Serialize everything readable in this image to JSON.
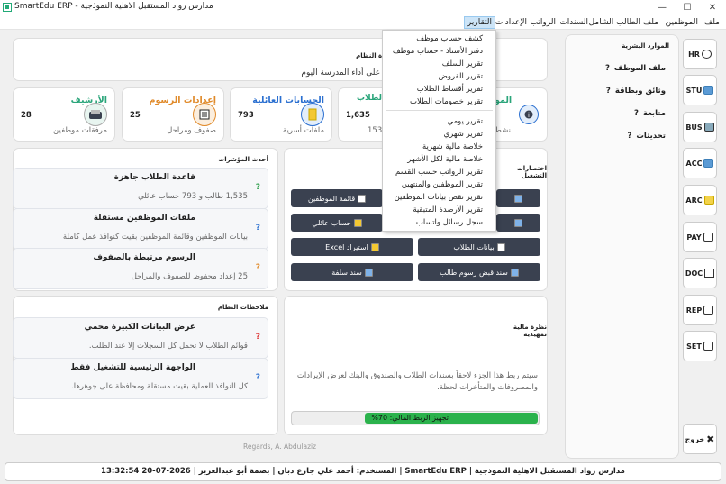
{
  "window": {
    "title": "مدارس رواد المستقبل الاهلية النموذجية - SmartEdu ERP",
    "minimize_label": "—",
    "maximize_label": "☐",
    "close_label": "✕"
  },
  "menubar": {
    "items": [
      "ملف",
      "الموظفين",
      "ملف الطالب الشامل",
      "السندات",
      "الرواتب",
      "الإعدادات",
      "التقارير"
    ],
    "active": "التقارير"
  },
  "reports_menu": {
    "items": [
      "كشف حساب موظف",
      "دفتر الأستاذ - حساب موظف",
      "تقرير السلف",
      "تقرير القروض",
      "تقرير أقساط الطلاب",
      "تقرير خصومات الطلاب",
      "تقرير يومي",
      "تقرير شهري",
      "خلاصة مالية شهرية",
      "خلاصة مالية لكل الأشهر",
      "تقرير الرواتب حسب القسم",
      "تقرير الموظفين والمنتهين",
      "تقرير نقص بيانات الموظفين",
      "تقرير الأرصدة المتبقية",
      "سجل رسائل واتساب"
    ]
  },
  "welcome": {
    "greeting": "مرحباً بكم في إدارة النظام",
    "subtitle": "إليكم نظرة عامة على أداء المدرسة اليوم"
  },
  "stats": [
    {
      "title": "الأرشيف",
      "value": "28",
      "sub": "مرفقات موظفين",
      "color": "#2aa57a"
    },
    {
      "title": "إعدادات الرسوم",
      "value": "25",
      "sub": "صفوف ومراحل",
      "color": "#e08a2a"
    },
    {
      "title": "الحسابات العائلية",
      "value": "793",
      "sub": "ملفات أسرية",
      "color": "#2a6fd0"
    },
    {
      "title": "الطلاب",
      "value": "1,635",
      "sub": "153",
      "color": "#2aa57a"
    }
  ],
  "stat_partial": {
    "title": "المو",
    "sub": "نشط"
  },
  "indicators": {
    "title": "أحدث المؤشرات",
    "items": [
      {
        "head": "قاعدة الطلاب جاهزة",
        "body": "1,535 طالب و 793 حساب عائلي"
      },
      {
        "head": "ملفات الموظفين مستقلة",
        "body": "بيانات الموظفين وقائمة الموظفين بقيت كنوافذ عمل كاملة"
      },
      {
        "head": "الرسوم مرتبطة بالصفوف",
        "body": "25 إعداد محفوظ للصفوف والمراحل"
      }
    ]
  },
  "notes": {
    "title": "ملاحظات النظام",
    "items": [
      {
        "head": "عرض البيانات الكبيرة محمي",
        "body": "قوائم الطلاب لا تحمل كل السجلات إلا عند الطلب."
      },
      {
        "head": "الواجهة الرئيسية للتشغيل فقط",
        "body": "كل النوافذ العملية بقيت مستقلة ومحافظة على جوهرها."
      }
    ]
  },
  "shortcuts": {
    "title": "اختصارات التشغيل",
    "buttons": [
      "قائمة الموظفين",
      "حساب عائلي",
      "استيراد Excel",
      "بيانات الطلاب",
      "سند سلفة",
      "سند قبض رسوم طالب"
    ]
  },
  "financial": {
    "title": "نظرة مالية تمهيدية",
    "body": "سيتم ربط هذا الجزء لاحقاً بسندات الطلاب والصندوق والبنك لعرض الإيرادات والمصروفات والمتأخرات لحظة.",
    "progress_label": "تجهيز الربط المالي: 70%",
    "progress": 0.7
  },
  "signature": "Regards, A. Abdulaziz",
  "sidebar": {
    "title": "الموارد البشرية",
    "items": [
      "ملف الموظف",
      "وثائق وبطاقة",
      "متابعة",
      "تحديثات"
    ]
  },
  "nav": [
    "HR",
    "STU",
    "BUS",
    "ACC",
    "ARC",
    "PAY",
    "DOC",
    "REP",
    "SET"
  ],
  "exit_label": "خروج",
  "status_bar": "مدارس رواد المستقبل الاهلية النموذجية  |  SmartEdu ERP  |  المستخدم: أحمد علي جارع دبان  |  بصمة أبو عبدالعزيز  |  2026-07-20  13:32:54"
}
